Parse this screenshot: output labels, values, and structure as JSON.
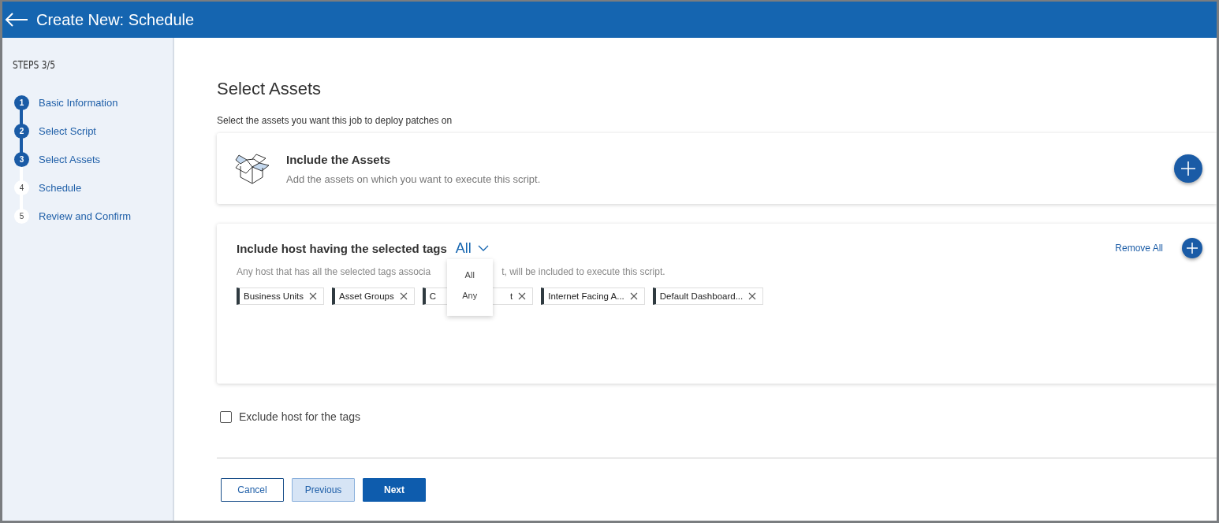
{
  "header": {
    "title": "Create New: Schedule"
  },
  "sidebar": {
    "steps_label": "STEPS 3/5",
    "steps": [
      {
        "number": "1",
        "label": "Basic Information",
        "completed": true
      },
      {
        "number": "2",
        "label": "Select Script",
        "completed": true
      },
      {
        "number": "3",
        "label": "Select Assets",
        "completed": true
      },
      {
        "number": "4",
        "label": "Schedule",
        "completed": false
      },
      {
        "number": "5",
        "label": "Review and Confirm",
        "completed": false
      }
    ]
  },
  "page": {
    "title": "Select Assets",
    "subtitle": "Select the assets you want this job to deploy patches on"
  },
  "include_card": {
    "title": "Include the Assets",
    "description": "Add the assets on which you want to execute this script."
  },
  "tags_card": {
    "title": "Include host having the selected tags",
    "match_value": "All",
    "remove_all": "Remove All",
    "description_before": "Any host that has all the selected tags associa",
    "description_after": "t, will be included to execute this script.",
    "tags": [
      {
        "label": "Business Units"
      },
      {
        "label": "Asset Groups"
      },
      {
        "label": "C",
        "label_after": "t"
      },
      {
        "label": "Internet Facing A..."
      },
      {
        "label": "Default Dashboard..."
      }
    ],
    "dropdown": {
      "options": [
        "All",
        "Any"
      ]
    }
  },
  "exclude": {
    "label": "Exclude host for the tags",
    "checked": false
  },
  "buttons": [
    {
      "label": "Cancel",
      "kind": "outline"
    },
    {
      "label": "Previous",
      "kind": "secondary"
    },
    {
      "label": "Next",
      "kind": "primary"
    }
  ]
}
